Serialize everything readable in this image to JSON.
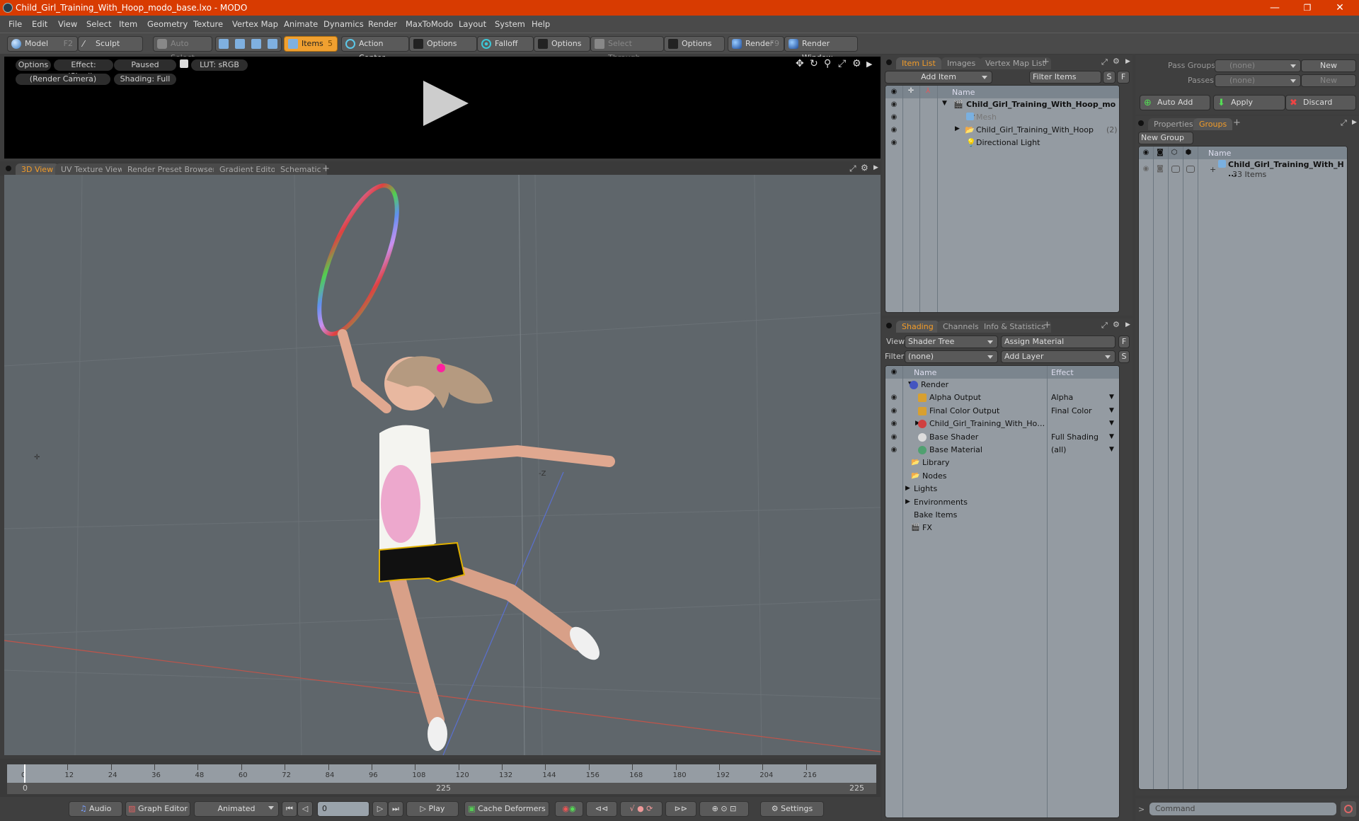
{
  "window": {
    "title": "Child_Girl_Training_With_Hoop_modo_base.lxo - MODO",
    "controls": {
      "minimize": "—",
      "restore": "❐",
      "close": "✕"
    }
  },
  "menu": [
    "File",
    "Edit",
    "View",
    "Select",
    "Item",
    "Geometry",
    "Texture",
    "Vertex Map",
    "Animate",
    "Dynamics",
    "Render",
    "MaxToModo",
    "Layout",
    "System",
    "Help"
  ],
  "toolbar": {
    "model": "Model",
    "model_key": "F2",
    "sculpt": "Sculpt",
    "auto_select": "Auto Select",
    "items": "Items",
    "items_key": "5",
    "action_center": "Action Center",
    "options1": "Options",
    "falloff": "Falloff",
    "options2": "Options",
    "select_through": "Select Through",
    "options3": "Options",
    "render": "Render",
    "render_key": "F9",
    "render_window": "Render Window"
  },
  "preview": {
    "options": "Options",
    "effect": "Effect: (Shadi...",
    "status": "Paused",
    "lut": "LUT: sRGB",
    "camera": "(Render Camera)",
    "shading": "Shading: Full"
  },
  "viewport_tabs": [
    "3D View",
    "UV Texture View",
    "Render Preset Browser",
    "Gradient Editor",
    "Schematic",
    "+"
  ],
  "viewport": {
    "axis_label": "-Z"
  },
  "timeline": {
    "ticks": [
      "0",
      "12",
      "24",
      "36",
      "48",
      "60",
      "72",
      "84",
      "96",
      "108",
      "120",
      "132",
      "144",
      "156",
      "168",
      "180",
      "192",
      "204",
      "216"
    ],
    "range_start": "0",
    "range_mid": "225",
    "range_end": "225",
    "current_frame": "0"
  },
  "transport": {
    "audio": "Audio",
    "graph_editor": "Graph Editor",
    "mode": "Animated",
    "play": "Play",
    "cache_deformers": "Cache Deformers",
    "settings": "Settings"
  },
  "item_list": {
    "tabs": [
      "Item List",
      "Images",
      "Vertex Map List",
      "+"
    ],
    "add_item": "Add Item",
    "filter_placeholder": "Filter Items",
    "s_btn": "S",
    "f_btn": "F",
    "col_name": "Name",
    "rows": [
      {
        "name": "Child_Girl_Training_With_Hoop_mo ...",
        "bold": true,
        "icon": "scene-icon"
      },
      {
        "name": "Mesh",
        "dim": true,
        "icon": "mesh-icon"
      },
      {
        "name": "Child_Girl_Training_With_Hoop",
        "count": "(2)",
        "icon": "group-folder-icon"
      },
      {
        "name": "Directional Light",
        "icon": "light-icon"
      }
    ]
  },
  "shading": {
    "tabs": [
      "Shading",
      "Channels",
      "Info & Statistics",
      "+"
    ],
    "view_label": "View",
    "view_value": "Shader Tree",
    "assign_material": "Assign Material",
    "f_btn": "F",
    "filter_label": "Filter",
    "filter_value": "(none)",
    "add_layer": "Add Layer",
    "s_btn": "S",
    "col_name": "Name",
    "col_effect": "Effect",
    "rows": [
      {
        "name": "Render",
        "effect": "",
        "indent": 0
      },
      {
        "name": "Alpha Output",
        "effect": "Alpha",
        "indent": 1
      },
      {
        "name": "Final Color Output",
        "effect": "Final Color",
        "indent": 1
      },
      {
        "name": "Child_Girl_Training_With_Ho…",
        "effect": "",
        "indent": 1
      },
      {
        "name": "Base Shader",
        "effect": "Full Shading",
        "indent": 1
      },
      {
        "name": "Base Material",
        "effect": "(all)",
        "indent": 1
      },
      {
        "name": "Library",
        "effect": "",
        "indent": 2
      },
      {
        "name": "Nodes",
        "effect": "",
        "indent": 2
      },
      {
        "name": "Lights",
        "effect": "",
        "indent": 3
      },
      {
        "name": "Environments",
        "effect": "",
        "indent": 3
      },
      {
        "name": "Bake Items",
        "effect": "",
        "indent": 3
      },
      {
        "name": "FX",
        "effect": "",
        "indent": 2
      }
    ]
  },
  "passes": {
    "pass_groups_label": "Pass Groups",
    "pass_groups_value": "(none)",
    "new1": "New",
    "passes_label": "Passes",
    "passes_value": "(none)",
    "new2": "New",
    "auto_add": "Auto Add",
    "apply": "Apply",
    "discard": "Discard"
  },
  "groups": {
    "tabs": [
      "Properties",
      "Groups",
      "+"
    ],
    "new_group": "New Group",
    "col_name": "Name",
    "row_name": "Child_Girl_Training_With_H ...",
    "row_count": "33 Items"
  },
  "command": {
    "placeholder": "Command",
    "prompt": ">"
  },
  "colors": {
    "accent": "#f39c28",
    "titlebar": "#d83b01",
    "viewport_bg": "#5f666b",
    "list_bg": "#949ba2"
  }
}
